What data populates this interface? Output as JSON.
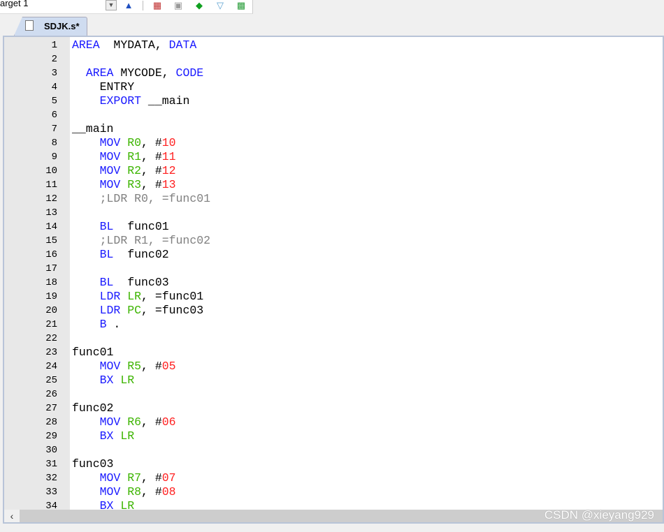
{
  "toolbar": {
    "target": "arget 1",
    "icons": [
      "dropdown-icon",
      "manage-project-icon",
      "configure-icon",
      "windows-icon",
      "pack-installer-icon",
      "filter-icon",
      "event-recorder-icon"
    ]
  },
  "tab": {
    "label": "SDJK.s*"
  },
  "colors": {
    "keyword": "#1a1aff",
    "register": "#3cb400",
    "number": "#ff2020",
    "comment": "#808080"
  },
  "code": [
    [
      [
        "kw",
        "AREA"
      ],
      [
        "",
        "  MYDATA, "
      ],
      [
        "kw",
        "DATA"
      ]
    ],
    [],
    [
      [
        "",
        "  "
      ],
      [
        "kw",
        "AREA"
      ],
      [
        "",
        " MYCODE, "
      ],
      [
        "kw",
        "CODE"
      ]
    ],
    [
      [
        "",
        "    ENTRY"
      ]
    ],
    [
      [
        "",
        "    "
      ],
      [
        "kw",
        "EXPORT"
      ],
      [
        "",
        " __main"
      ]
    ],
    [],
    [
      [
        "",
        "__main"
      ]
    ],
    [
      [
        "",
        "    "
      ],
      [
        "kw",
        "MOV"
      ],
      [
        "",
        " "
      ],
      [
        "reg",
        "R0"
      ],
      [
        "",
        ", #"
      ],
      [
        "n",
        "10"
      ]
    ],
    [
      [
        "",
        "    "
      ],
      [
        "kw",
        "MOV"
      ],
      [
        "",
        " "
      ],
      [
        "reg",
        "R1"
      ],
      [
        "",
        ", #"
      ],
      [
        "n",
        "11"
      ]
    ],
    [
      [
        "",
        "    "
      ],
      [
        "kw",
        "MOV"
      ],
      [
        "",
        " "
      ],
      [
        "reg",
        "R2"
      ],
      [
        "",
        ", #"
      ],
      [
        "n",
        "12"
      ]
    ],
    [
      [
        "",
        "    "
      ],
      [
        "kw",
        "MOV"
      ],
      [
        "",
        " "
      ],
      [
        "reg",
        "R3"
      ],
      [
        "",
        ", #"
      ],
      [
        "n",
        "13"
      ]
    ],
    [
      [
        "",
        "    "
      ],
      [
        "cm",
        ";LDR R0, =func01"
      ]
    ],
    [],
    [
      [
        "",
        "    "
      ],
      [
        "kw",
        "BL"
      ],
      [
        "",
        "  func01"
      ]
    ],
    [
      [
        "",
        "    "
      ],
      [
        "cm",
        ";LDR R1, =func02"
      ]
    ],
    [
      [
        "",
        "    "
      ],
      [
        "kw",
        "BL"
      ],
      [
        "",
        "  func02"
      ]
    ],
    [],
    [
      [
        "",
        "    "
      ],
      [
        "kw",
        "BL"
      ],
      [
        "",
        "  func03"
      ]
    ],
    [
      [
        "",
        "    "
      ],
      [
        "kw",
        "LDR"
      ],
      [
        "",
        " "
      ],
      [
        "reg",
        "LR"
      ],
      [
        "",
        ", =func01"
      ]
    ],
    [
      [
        "",
        "    "
      ],
      [
        "kw",
        "LDR"
      ],
      [
        "",
        " "
      ],
      [
        "reg",
        "PC"
      ],
      [
        "",
        ", =func03"
      ]
    ],
    [
      [
        "",
        "    "
      ],
      [
        "kw",
        "B"
      ],
      [
        "",
        " ."
      ]
    ],
    [],
    [
      [
        "",
        "func01"
      ]
    ],
    [
      [
        "",
        "    "
      ],
      [
        "kw",
        "MOV"
      ],
      [
        "",
        " "
      ],
      [
        "reg",
        "R5"
      ],
      [
        "",
        ", #"
      ],
      [
        "n",
        "05"
      ]
    ],
    [
      [
        "",
        "    "
      ],
      [
        "kw",
        "BX"
      ],
      [
        "",
        " "
      ],
      [
        "reg",
        "LR"
      ]
    ],
    [],
    [
      [
        "",
        "func02"
      ]
    ],
    [
      [
        "",
        "    "
      ],
      [
        "kw",
        "MOV"
      ],
      [
        "",
        " "
      ],
      [
        "reg",
        "R6"
      ],
      [
        "",
        ", #"
      ],
      [
        "n",
        "06"
      ]
    ],
    [
      [
        "",
        "    "
      ],
      [
        "kw",
        "BX"
      ],
      [
        "",
        " "
      ],
      [
        "reg",
        "LR"
      ]
    ],
    [],
    [
      [
        "",
        "func03"
      ]
    ],
    [
      [
        "",
        "    "
      ],
      [
        "kw",
        "MOV"
      ],
      [
        "",
        " "
      ],
      [
        "reg",
        "R7"
      ],
      [
        "",
        ", #"
      ],
      [
        "n",
        "07"
      ]
    ],
    [
      [
        "",
        "    "
      ],
      [
        "kw",
        "MOV"
      ],
      [
        "",
        " "
      ],
      [
        "reg",
        "R8"
      ],
      [
        "",
        ", #"
      ],
      [
        "n",
        "08"
      ]
    ],
    [
      [
        "",
        "    "
      ],
      [
        "kw",
        "BX"
      ],
      [
        "",
        " "
      ],
      [
        "reg",
        "LR"
      ]
    ]
  ],
  "watermark": "CSDN @xieyang929"
}
